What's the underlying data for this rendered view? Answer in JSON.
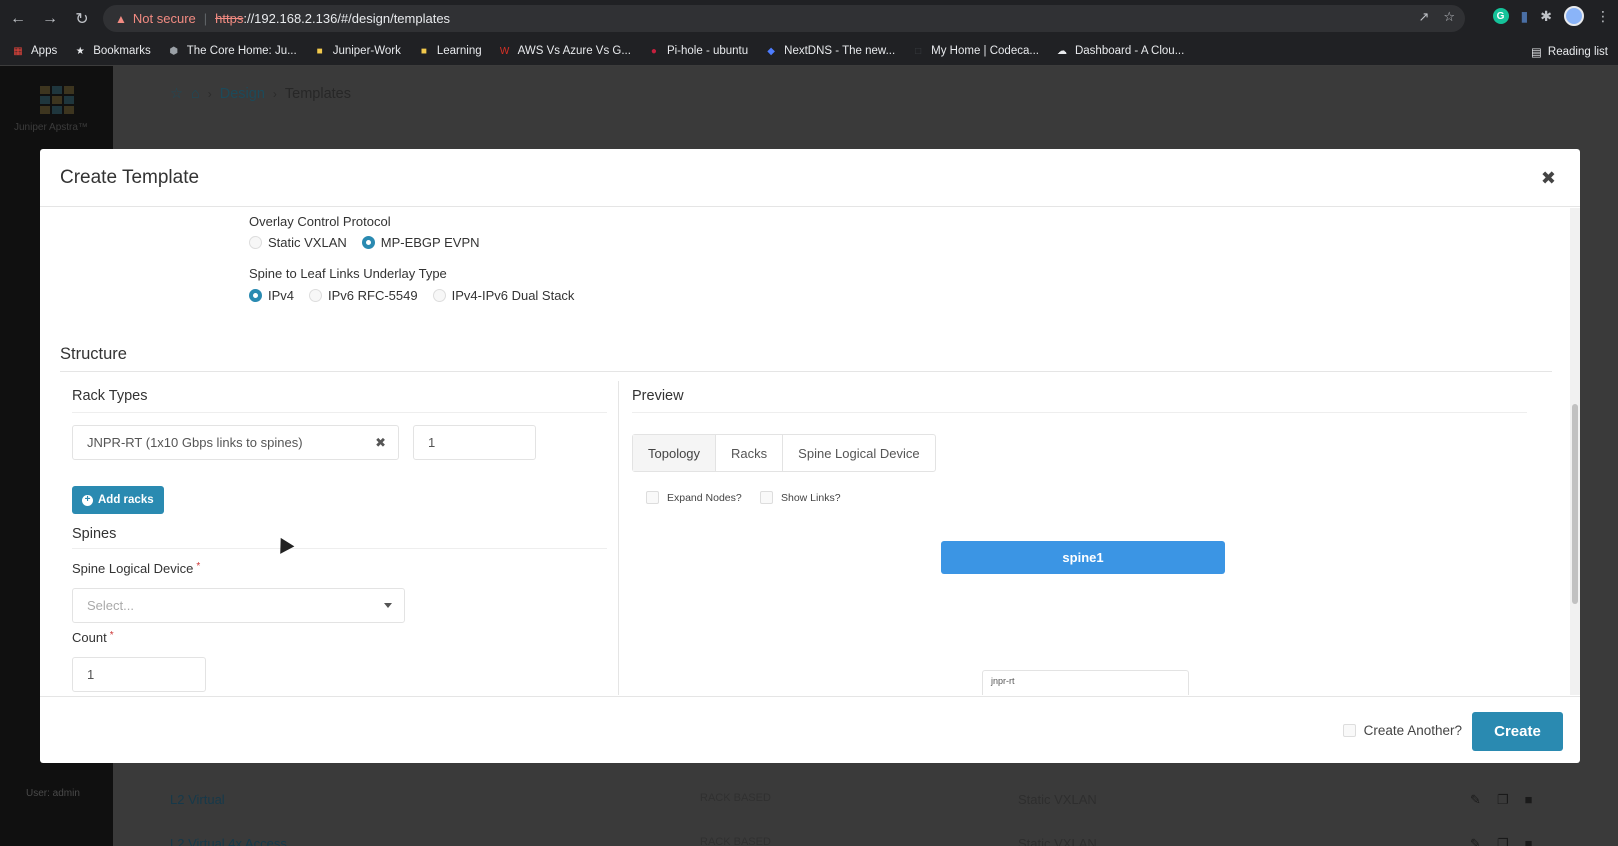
{
  "browser": {
    "not_secure": "Not secure",
    "url_scheme": "https",
    "url_rest": "://192.168.2.136/#/design/templates",
    "bookmarks": [
      "Apps",
      "Bookmarks",
      "The Core Home: Ju...",
      "Juniper-Work",
      "Learning",
      "AWS Vs Azure Vs G...",
      "Pi-hole - ubuntu",
      "NextDNS - The new...",
      "My Home | Codeca...",
      "Dashboard - A Clou..."
    ],
    "reading_list": "Reading list"
  },
  "app": {
    "logo_text": "Juniper Apstra™",
    "user": "User: admin",
    "breadcrumb": {
      "design": "Design",
      "templates": "Templates"
    },
    "rows": [
      {
        "name": "L2 Virtual",
        "type": "RACK BASED",
        "protocol": "Static VXLAN"
      },
      {
        "name": "L2 Virtual 4x Access",
        "type": "RACK BASED",
        "protocol": "Static VXLAN"
      }
    ]
  },
  "modal": {
    "title": "Create Template",
    "overlay": {
      "label": "Overlay Control Protocol",
      "options": [
        "Static VXLAN",
        "MP-EBGP EVPN"
      ],
      "selected": "MP-EBGP EVPN"
    },
    "underlay": {
      "label": "Spine to Leaf Links Underlay Type",
      "options": [
        "IPv4",
        "IPv6 RFC-5549",
        "IPv4-IPv6 Dual Stack"
      ],
      "selected": "IPv4"
    },
    "structure": {
      "title": "Structure",
      "rack_types": {
        "title": "Rack Types",
        "selected": "JNPR-RT (1x10 Gbps links to spines)",
        "count": "1",
        "add_label": "Add racks"
      },
      "spines": {
        "title": "Spines",
        "logical_device_label": "Spine Logical Device",
        "logical_device_placeholder": "Select...",
        "count_label": "Count",
        "count_value": "1"
      }
    },
    "preview": {
      "title": "Preview",
      "tabs": [
        "Topology",
        "Racks",
        "Spine Logical Device"
      ],
      "active_tab": "Topology",
      "expand_nodes": "Expand Nodes?",
      "show_links": "Show Links?",
      "spine_node": "spine1",
      "rack_label": "jnpr-rt"
    },
    "footer": {
      "create_another": "Create Another?",
      "create": "Create"
    }
  },
  "colors": {
    "accent": "#2a8ab1",
    "spine_node": "#3b95e4",
    "rack_bar": "#a9d3f5"
  }
}
